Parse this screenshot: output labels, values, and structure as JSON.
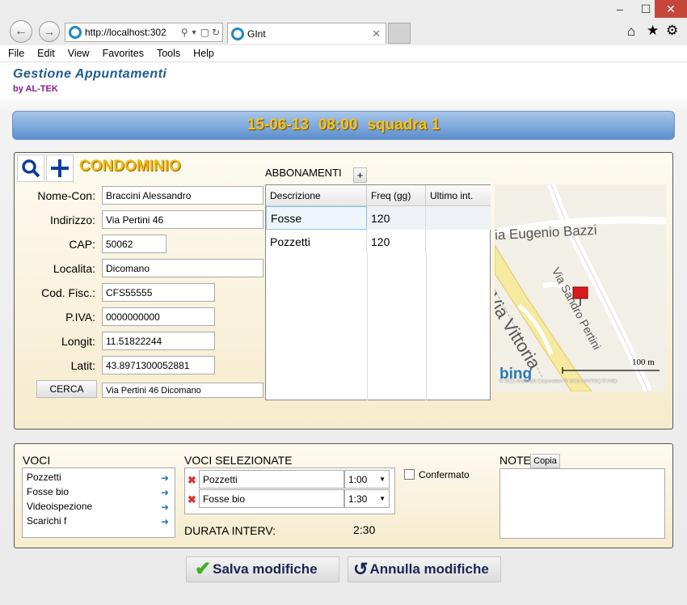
{
  "browser": {
    "address": "http://localhost:302",
    "tab_title": "GInt",
    "menu": [
      "File",
      "Edit",
      "View",
      "Favorites",
      "Tools",
      "Help"
    ]
  },
  "app": {
    "title": "Gestione Appuntamenti",
    "subtitle": "by AL-TEK",
    "banner": {
      "date": "15-06-13",
      "time": "08:00",
      "team": "squadra 1"
    }
  },
  "condominio": {
    "heading": "CONDOMINIO",
    "fields": {
      "nome_label": "Nome-Con:",
      "nome": "Braccini Alessandro",
      "indirizzo_label": "Indirizzo:",
      "indirizzo": "Via Pertini 46",
      "cap_label": "CAP:",
      "cap": "50062",
      "localita_label": "Localita:",
      "localita": "Dicomano",
      "codfisc_label": "Cod. Fisc.:",
      "codfisc": "CFS55555",
      "piva_label": "P.IVA:",
      "piva": "0000000000",
      "longit_label": "Longit:",
      "longit": "11.51822244",
      "latit_label": "Latit:",
      "latit": "43.8971300052881"
    },
    "search_button": "CERCA",
    "search_value": "Via Pertini 46 Dicomano"
  },
  "abbonamenti": {
    "label": "ABBONAMENTI",
    "add": "+",
    "headers": [
      "Descrizione",
      "Freq (gg)",
      "Ultimo int."
    ],
    "rows": [
      {
        "descr": "Fosse",
        "freq": "120",
        "ultimo": ""
      },
      {
        "descr": "Pozzetti",
        "freq": "120",
        "ultimo": ""
      }
    ]
  },
  "map": {
    "street1": "ia Eugenio Bazzi",
    "street2": "Via Vittoria",
    "street3": "Via Sandro Pertini",
    "scale": "100 m",
    "brand": "bing",
    "copyright": "© 2013 Microsoft Corporation    © 2010 NAVTEQ  © AND"
  },
  "voci": {
    "label": "VOCI",
    "items": [
      "Pozzetti",
      "Fosse bio",
      "Videoispezione",
      "Scarichi f"
    ]
  },
  "voci_selezionate": {
    "label": "VOCI SELEZIONATE",
    "items": [
      {
        "name": "Pozzetti",
        "time": "1:00"
      },
      {
        "name": "Fosse bio",
        "time": "1:30"
      }
    ],
    "durata_label": "DURATA INTERV:",
    "durata": "2:30",
    "confermato": "Confermato"
  },
  "note": {
    "label": "NOTE",
    "copy": "Copia"
  },
  "actions": {
    "save": "Salva modifiche",
    "cancel": "Annulla modifiche"
  },
  "colors": {
    "banner_text": "#f6c21a",
    "accent_blue": "#0d3e9a",
    "title_blue": "#1f5b8f",
    "subtitle_purple": "#8a1a8a"
  }
}
